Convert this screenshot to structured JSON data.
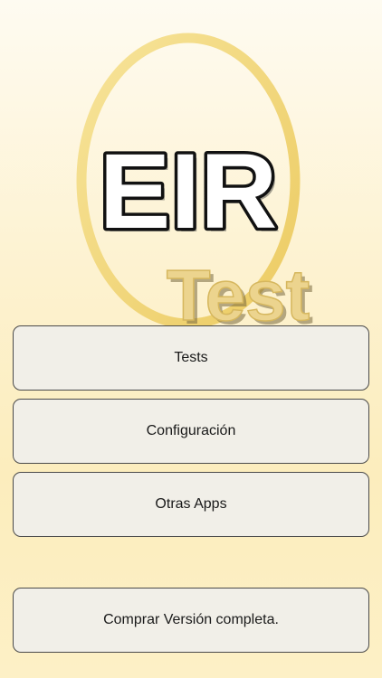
{
  "logo": {
    "title": "EIR",
    "subtitle": "Test"
  },
  "menu": {
    "tests": "Tests",
    "configuracion": "Configuración",
    "otras_apps": "Otras Apps",
    "comprar": "Comprar Versión completa."
  },
  "colors": {
    "ring": "#f3d97a",
    "test_fill": "#e9d18a",
    "button_bg": "#f1efe8",
    "button_border": "#4a4a4a"
  }
}
